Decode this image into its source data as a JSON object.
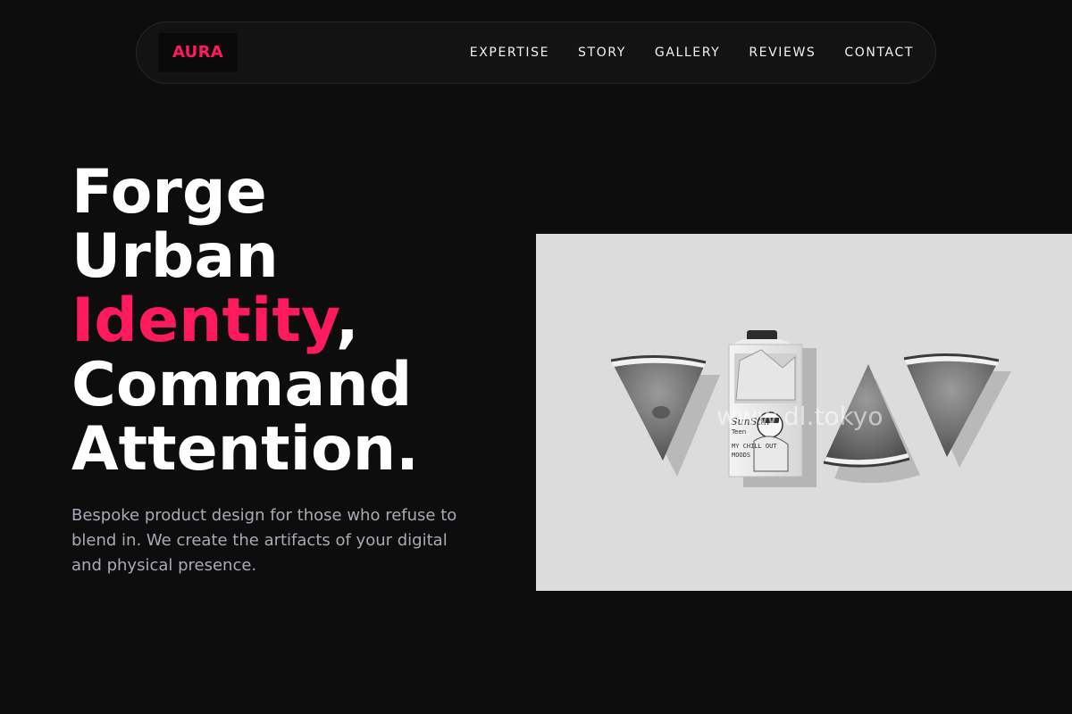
{
  "nav": {
    "logo": "AURA",
    "links": [
      "EXPERTISE",
      "STORY",
      "GALLERY",
      "REVIEWS",
      "CONTACT"
    ]
  },
  "hero": {
    "line1": "Forge",
    "line2": "Urban",
    "line3_accent": "Identity",
    "line3_rest": ",",
    "line4": "Command",
    "line5": "Attention.",
    "subtitle": "Bespoke product design for those who refuse to blend in. We create the artifacts of your digital and physical presence."
  },
  "image": {
    "watermark": "www.dl.tokyo",
    "carton_brand": "SunStar",
    "carton_sub": "Teen",
    "carton_tagline_1": "MY CHILL OUT",
    "carton_tagline_2": "MOODS"
  },
  "colors": {
    "accent": "#ff1a5e",
    "background": "#0d0d0d",
    "text": "#ffffff",
    "muted": "#a8abb6"
  }
}
